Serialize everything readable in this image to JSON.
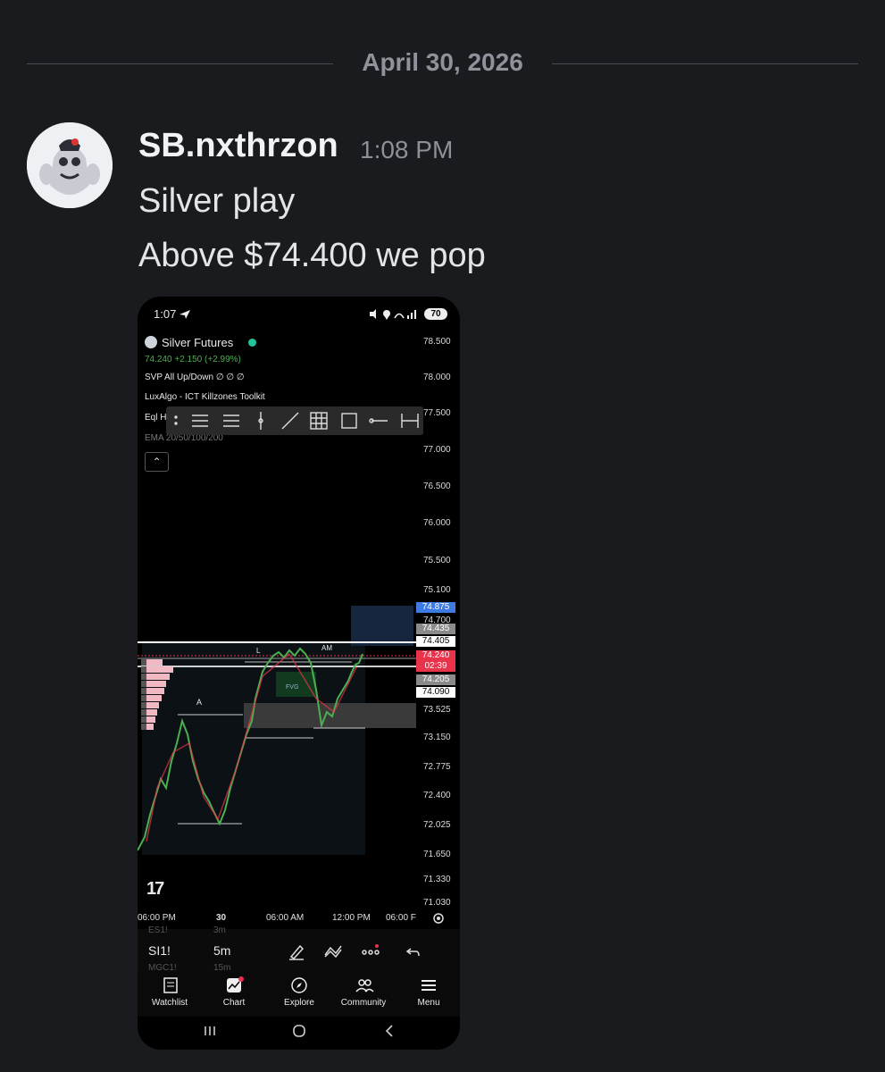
{
  "divider": {
    "date": "April 30, 2026"
  },
  "message": {
    "author": "SB.nxthrzon",
    "time": "1:08 PM",
    "lines": [
      "Silver play",
      "Above $74.400 we pop"
    ]
  },
  "phone": {
    "status_time": "1:07",
    "battery": "70",
    "instrument": "Silver Futures",
    "quote": "74.240  +2.150 (+2.99%)",
    "indicators": [
      "SVP All Up/Down  ∅ ∅ ∅",
      "LuxAlgo - ICT Killzones Toolkit",
      "Eql H",
      "EMA 20/50/100/200"
    ],
    "price_axis": [
      "78.500",
      "78.000",
      "77.500",
      "77.000",
      "76.500",
      "76.000",
      "75.500",
      "75.100",
      "74.700",
      "73.525",
      "73.150",
      "72.775",
      "72.400",
      "72.025",
      "71.650",
      "71.330",
      "71.030"
    ],
    "price_labels": [
      {
        "text": "74.875",
        "color": "#3d7be3"
      },
      {
        "text": "74.435",
        "color": "#9a9a9a"
      },
      {
        "text": "74.405",
        "color": "#ffffff"
      },
      {
        "text": "74.240",
        "color": "#e8334a"
      },
      {
        "text": "02:39",
        "color": "#e8334a"
      },
      {
        "text": "74.205",
        "color": "#9a9a9a"
      },
      {
        "text": "74.090",
        "color": "#ffffff"
      }
    ],
    "chart_labels": {
      "l": "L",
      "am": "AM",
      "a": "A",
      "fvg": "FVG"
    },
    "time_axis": [
      "06:00 PM",
      "30",
      "06:00 AM",
      "12:00 PM",
      "06:00 F"
    ],
    "symbols": {
      "prev": "ES1!",
      "current": "SI1!",
      "next": "MGC1!"
    },
    "intervals": {
      "prev": "3m",
      "current": "5m",
      "next": "15m"
    },
    "nav": [
      "Watchlist",
      "Chart",
      "Explore",
      "Community",
      "Menu"
    ],
    "logo": "17"
  },
  "colors": {
    "background": "#1a1b1e",
    "accent_red": "#e8334a",
    "accent_blue": "#3d7be3",
    "up_green": "#4caf50"
  }
}
